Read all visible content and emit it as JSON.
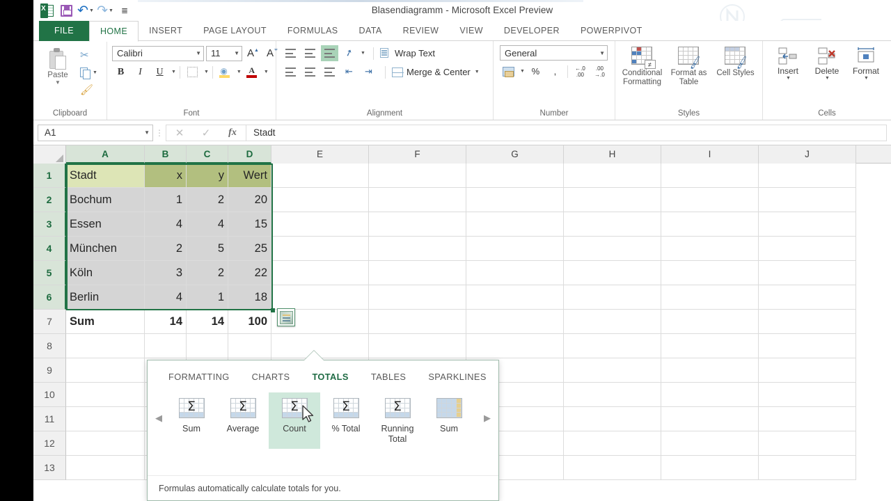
{
  "titlebar": {
    "window_title": "Blasendiagramm - Microsoft Excel Preview",
    "quick_access": [
      {
        "name": "excel-logo",
        "label": ""
      },
      {
        "name": "save",
        "label": "Save"
      },
      {
        "name": "undo",
        "label": "Undo"
      },
      {
        "name": "redo",
        "label": "Redo"
      },
      {
        "name": "customize",
        "label": "Customize Quick Access Toolbar"
      }
    ]
  },
  "ribbon": {
    "tabs": [
      {
        "label": "FILE",
        "active": false
      },
      {
        "label": "HOME",
        "active": true
      },
      {
        "label": "INSERT",
        "active": false
      },
      {
        "label": "PAGE LAYOUT",
        "active": false
      },
      {
        "label": "FORMULAS",
        "active": false
      },
      {
        "label": "DATA",
        "active": false
      },
      {
        "label": "REVIEW",
        "active": false
      },
      {
        "label": "VIEW",
        "active": false
      },
      {
        "label": "DEVELOPER",
        "active": false
      },
      {
        "label": "POWERPIVOT",
        "active": false
      }
    ],
    "groups": {
      "clipboard": {
        "label": "Clipboard",
        "paste": "Paste",
        "cut": "Cut",
        "copy": "Copy",
        "format_painter": "Format Painter"
      },
      "font": {
        "label": "Font",
        "font_name": "Calibri",
        "font_size": "11",
        "grow_font": "A",
        "shrink_font": "A",
        "bold": "B",
        "italic": "I",
        "underline": "U"
      },
      "alignment": {
        "label": "Alignment",
        "wrap_text": "Wrap Text",
        "merge_center": "Merge & Center"
      },
      "number": {
        "label": "Number",
        "format": "General",
        "percent": "%",
        "comma": ","
      },
      "styles": {
        "label": "Styles",
        "conditional_formatting": "Conditional Formatting",
        "format_as_table": "Format as Table",
        "cell_styles": "Cell Styles"
      },
      "cells": {
        "label": "Cells",
        "insert": "Insert",
        "delete": "Delete",
        "format": "Format"
      }
    }
  },
  "formula_bar": {
    "name_box": "A1",
    "cancel": "✕",
    "enter": "✓",
    "insert_function": "fx",
    "formula_value": "Stadt"
  },
  "sheet": {
    "column_headers": [
      "A",
      "B",
      "C",
      "D",
      "E",
      "F",
      "G",
      "H",
      "I",
      "J"
    ],
    "selected_columns": [
      "A",
      "B",
      "C",
      "D"
    ],
    "row_headers": [
      "1",
      "2",
      "3",
      "4",
      "5",
      "6",
      "7",
      "8",
      "9",
      "10",
      "11",
      "12",
      "13"
    ],
    "selected_rows": [
      "1",
      "2",
      "3",
      "4",
      "5",
      "6"
    ],
    "data": [
      {
        "row": "1",
        "cells": [
          "Stadt",
          "x",
          "y",
          "Wert"
        ]
      },
      {
        "row": "2",
        "cells": [
          "Bochum",
          "1",
          "2",
          "20"
        ]
      },
      {
        "row": "3",
        "cells": [
          "Essen",
          "4",
          "4",
          "15"
        ]
      },
      {
        "row": "4",
        "cells": [
          "München",
          "2",
          "5",
          "25"
        ]
      },
      {
        "row": "5",
        "cells": [
          "Köln",
          "3",
          "2",
          "22"
        ]
      },
      {
        "row": "6",
        "cells": [
          "Berlin",
          "4",
          "1",
          "18"
        ]
      },
      {
        "row": "7",
        "cells": [
          "Sum",
          "14",
          "14",
          "100"
        ]
      }
    ],
    "quick_analysis_button": "Quick Analysis"
  },
  "quick_analysis": {
    "tabs": [
      {
        "label": "FORMATTING",
        "active": false
      },
      {
        "label": "CHARTS",
        "active": false
      },
      {
        "label": "TOTALS",
        "active": true
      },
      {
        "label": "TABLES",
        "active": false
      },
      {
        "label": "SPARKLINES",
        "active": false
      }
    ],
    "items": [
      {
        "label": "Sum",
        "selected": false,
        "orientation": "row"
      },
      {
        "label": "Average",
        "selected": false,
        "orientation": "row"
      },
      {
        "label": "Count",
        "selected": true,
        "orientation": "row"
      },
      {
        "label": "% Total",
        "selected": false,
        "orientation": "row"
      },
      {
        "label": "Running Total",
        "selected": false,
        "orientation": "row"
      },
      {
        "label": "Sum",
        "selected": false,
        "orientation": "column"
      }
    ],
    "prev_arrow": "◀",
    "next_arrow": "▶",
    "footer": "Formulas automatically calculate totals for you."
  },
  "colors": {
    "excel_green": "#217346",
    "file_tab": "#217346",
    "selection_border": "#217346",
    "header_fill": "#b2bf7f",
    "a1_fill": "#dde5b6",
    "selection_fill": "#d5d5d5",
    "qa_selected": "#cfe8db"
  }
}
